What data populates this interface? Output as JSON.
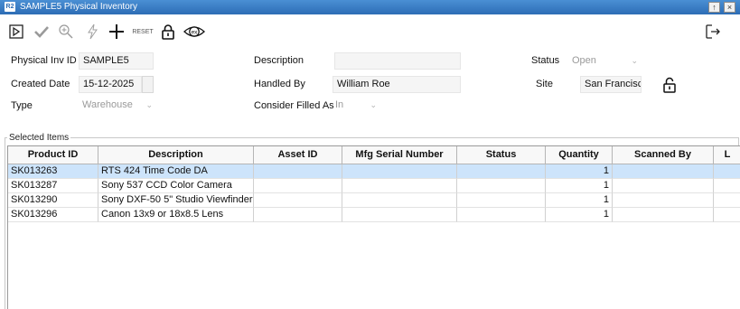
{
  "window": {
    "badge": "R2",
    "title": "SAMPLE5 Physical Inventory",
    "btn_restore": "↑",
    "btn_close": "×"
  },
  "toolbar": {
    "reset_label": "RESET",
    "icons": [
      "play-icon",
      "check-icon",
      "zoom-icon",
      "lightning-icon",
      "plus-icon",
      "reset-text",
      "lock-icon",
      "ex-eye-icon",
      "exit-icon"
    ]
  },
  "form": {
    "phys_inv_id_label": "Physical Inv ID",
    "phys_inv_id_value": "SAMPLE5",
    "created_date_label": "Created Date",
    "created_date_value": "15-12-2025",
    "type_label": "Type",
    "type_value": "Warehouse",
    "description_label": "Description",
    "description_value": "",
    "handled_by_label": "Handled By",
    "handled_by_value": "William Roe",
    "consider_filled_label": "Consider Filled As",
    "consider_filled_value": "In",
    "status_label": "Status",
    "status_value": "Open",
    "site_label": "Site",
    "site_value": "San Francisco"
  },
  "items": {
    "group_label": "Selected Items",
    "columns": [
      "Product ID",
      "Description",
      "Asset ID",
      "Mfg Serial Number",
      "Status",
      "Quantity",
      "Scanned By",
      "L"
    ],
    "rows": [
      {
        "product_id": "SK013263",
        "description": "RTS 424 Time Code DA",
        "asset_id": "",
        "mfg_serial": "",
        "status": "",
        "quantity": "1",
        "scanned_by": "",
        "l": ""
      },
      {
        "product_id": "SK013287",
        "description": "Sony 537 CCD Color Camera",
        "asset_id": "",
        "mfg_serial": "",
        "status": "",
        "quantity": "1",
        "scanned_by": "",
        "l": ""
      },
      {
        "product_id": "SK013290",
        "description": "Sony DXF-50 5\" Studio Viewfinder",
        "asset_id": "",
        "mfg_serial": "",
        "status": "",
        "quantity": "1",
        "scanned_by": "",
        "l": ""
      },
      {
        "product_id": "SK013296",
        "description": "Canon 13x9 or 18x8.5 Lens",
        "asset_id": "",
        "mfg_serial": "",
        "status": "",
        "quantity": "1",
        "scanned_by": "",
        "l": ""
      }
    ],
    "selected_row": 0
  },
  "colors": {
    "titlebar": "#2d6db5",
    "selected_row": "#cde4fb"
  }
}
